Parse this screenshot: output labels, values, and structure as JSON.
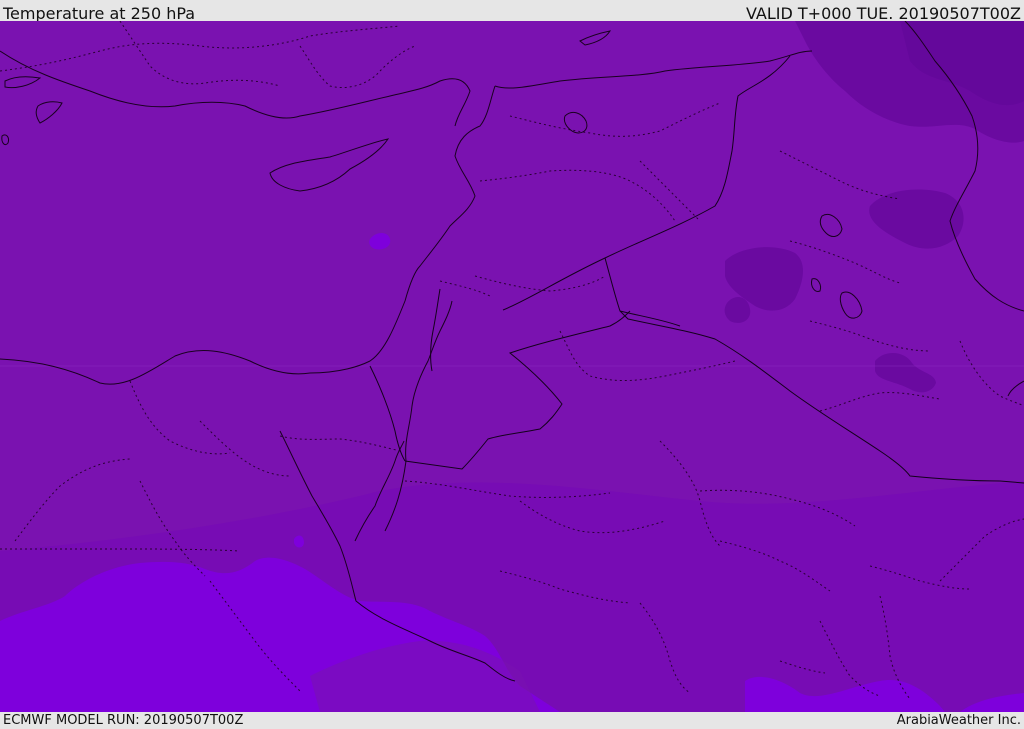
{
  "header": {
    "title": "Temperature at 250 hPa",
    "valid": "VALID T+000 TUE. 20190507T00Z"
  },
  "footer": {
    "model_run": "ECMWF MODEL RUN: 20190507T00Z",
    "credit": "ArabiaWeather Inc."
  },
  "colors": {
    "field_main": "#7a12b0",
    "field_cold": "#6a0aa0",
    "field_warm": "#7e00dc",
    "coastline": "#1a0020",
    "border_dotted": "#2a0035",
    "bar_bg": "#e6e6e6"
  }
}
